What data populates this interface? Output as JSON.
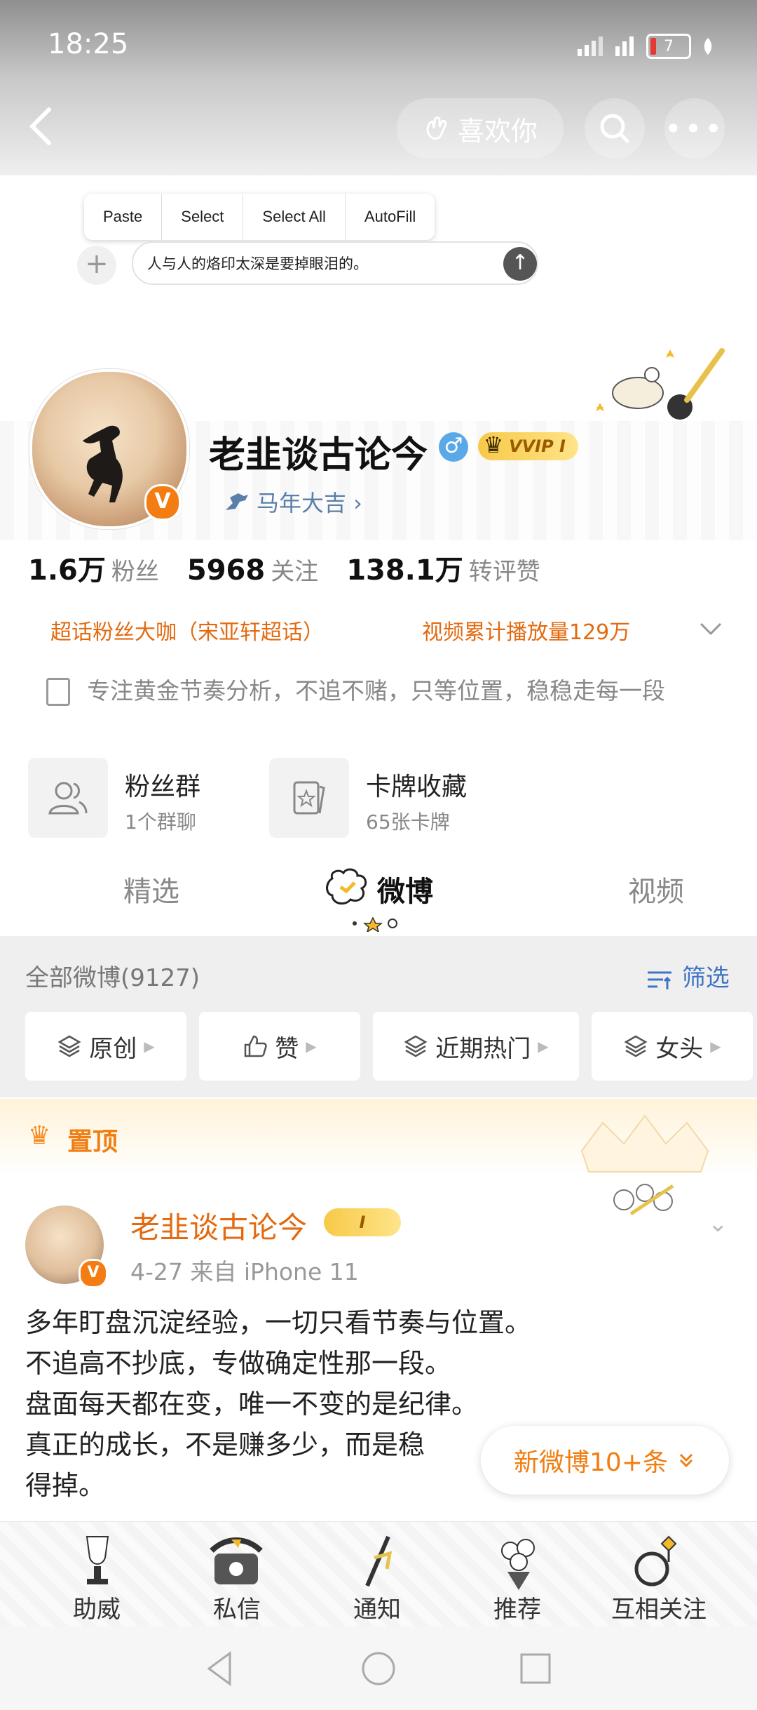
{
  "status_bar": {
    "time": "18:25",
    "battery": "7"
  },
  "header": {
    "like_label": "喜欢你"
  },
  "clipboard": {
    "menu": [
      "Paste",
      "Select",
      "Select All",
      "AutoFill"
    ],
    "compose_text": "人与人的烙印太深是要掉眼泪的。"
  },
  "profile": {
    "name": "老韭谈古论今",
    "male_symbol": "♂",
    "vip_label": "VVIP I",
    "tag": "马年大吉 ›",
    "verified": "V",
    "stats": [
      {
        "num": "1.6万",
        "label": "粉丝"
      },
      {
        "num": "5968",
        "label": "关注"
      },
      {
        "num": "138.1万",
        "label": "转评赞"
      }
    ],
    "honor_left": "超话粉丝大咖（宋亚轩超话）",
    "honor_right": "视频累计播放量129万",
    "bio": "专注黄金节奏分析，不追不赌，只等位置，稳稳走每一段"
  },
  "cards": [
    {
      "title": "粉丝群",
      "sub": "1个群聊"
    },
    {
      "title": "卡牌收藏",
      "sub": "65张卡牌"
    }
  ],
  "tabs": {
    "featured": "精选",
    "weibo": "微博",
    "video": "视频"
  },
  "filter": {
    "all_label": "全部微博(9127)",
    "filter_label": "筛选",
    "chips": [
      "原创",
      "赞",
      "近期热门",
      "女头"
    ]
  },
  "pinned": {
    "label": "置顶"
  },
  "post": {
    "author": "老韭谈古论今",
    "badge": "I",
    "meta": "4-27  来自 iPhone 11",
    "lines": [
      "多年盯盘沉淀经验，一切只看节奏与位置。",
      "不追高不抄底，专做确定性那一段。",
      "盘面每天都在变，唯一不变的是纪律。",
      "真正的成长，不是赚多少，而是稳",
      "得掉。"
    ]
  },
  "new_posts": {
    "label": "新微博10+条",
    "icon": "double-chevron-down"
  },
  "bottom_nav": [
    "助威",
    "私信",
    "通知",
    "推荐",
    "互相关注"
  ],
  "colors": {
    "accent_orange": "#f07e12",
    "link_blue": "#3d74c6",
    "vip_gold": "#f7c948"
  }
}
